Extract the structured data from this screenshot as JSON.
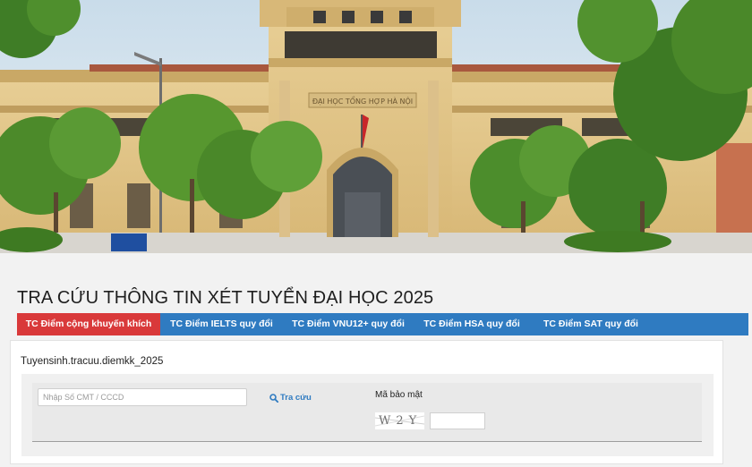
{
  "hero": {
    "building_sign": "ĐẠI HỌC TỔNG HỢP HÀ NỘI",
    "colors": {
      "sky": "#dfeaf2",
      "facade": "#e1c588",
      "trim": "#c9a866",
      "tree": "#4c8a2a",
      "road": "#d9d6d0"
    }
  },
  "page": {
    "title": "TRA CỨU THÔNG TIN XÉT TUYỂN ĐẠI HỌC 2025"
  },
  "tabs": [
    {
      "label": "TC Điểm cộng khuyến khích",
      "active": true
    },
    {
      "label": "TC Điểm IELTS quy đổi",
      "active": false
    },
    {
      "label": "TC Điểm VNU12+ quy đổi",
      "active": false
    },
    {
      "label": "TC Điểm HSA quy đổi",
      "active": false
    },
    {
      "label": "TC Điểm SAT quy đổi",
      "active": false
    }
  ],
  "form": {
    "dataset_name": "Tuyensinh.tracuu.diemkk_2025",
    "id_placeholder": "Nhập Số CMT / CCCD",
    "id_value": "",
    "lookup_label": "Tra cứu",
    "lookup_icon": "search-icon",
    "captcha_label": "Mã bảo mật",
    "captcha_text": "W2Y",
    "captcha_value": ""
  },
  "colors": {
    "tab_active": "#d9393a",
    "tab": "#2f7bc1",
    "link": "#2f7bc1"
  }
}
